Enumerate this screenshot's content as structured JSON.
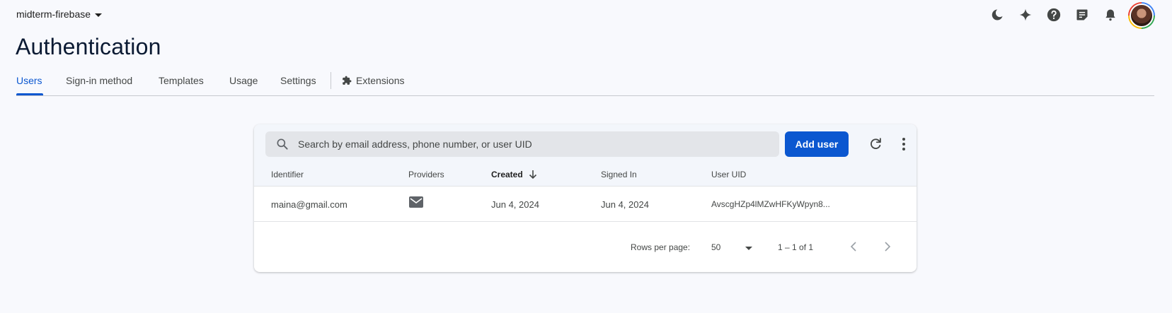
{
  "header": {
    "project_name": "midterm-firebase",
    "icons": [
      "dark-mode-icon",
      "sparkle-icon",
      "help-icon",
      "notes-icon",
      "notifications-icon",
      "avatar"
    ]
  },
  "page": {
    "title": "Authentication"
  },
  "tabs": [
    {
      "label": "Users",
      "active": true
    },
    {
      "label": "Sign-in method",
      "active": false
    },
    {
      "label": "Templates",
      "active": false
    },
    {
      "label": "Usage",
      "active": false
    },
    {
      "label": "Settings",
      "active": false
    },
    {
      "label": "Extensions",
      "active": false,
      "icon": "puzzle-icon"
    }
  ],
  "users_table": {
    "search_placeholder": "Search by email address, phone number, or user UID",
    "add_user_label": "Add user",
    "columns": [
      "Identifier",
      "Providers",
      "Created",
      "Signed In",
      "User UID"
    ],
    "sorted_column": "Created",
    "rows": [
      {
        "identifier": "maina@gmail.com",
        "provider_icon": "email-icon",
        "created": "Jun 4, 2024",
        "signed_in": "Jun 4, 2024",
        "uid": "AvscgHZp4lMZwHFKyWpyn8..."
      }
    ],
    "footer": {
      "rows_per_page_label": "Rows per page:",
      "rows_per_page_value": "50",
      "range": "1 – 1 of 1"
    }
  },
  "colors": {
    "accent": "#0b57d0",
    "background": "#f8f9fd"
  }
}
